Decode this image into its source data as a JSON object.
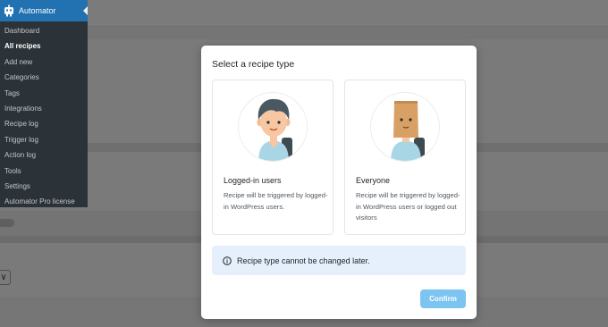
{
  "sidebar": {
    "title": "Automator",
    "items": [
      {
        "label": "Dashboard"
      },
      {
        "label": "All recipes"
      },
      {
        "label": "Add new"
      },
      {
        "label": "Categories"
      },
      {
        "label": "Tags"
      },
      {
        "label": "Integrations"
      },
      {
        "label": "Recipe log"
      },
      {
        "label": "Trigger log"
      },
      {
        "label": "Action log"
      },
      {
        "label": "Tools"
      },
      {
        "label": "Settings"
      },
      {
        "label": "Automator Pro license"
      }
    ],
    "active_item": "All recipes"
  },
  "background": {
    "select_glyph": "∨"
  },
  "modal": {
    "title": "Select a recipe type",
    "options": [
      {
        "title": "Logged-in users",
        "description": "Recipe will be triggered by logged-in WordPress users.",
        "icon": "user-avatar-icon"
      },
      {
        "title": "Everyone",
        "description": "Recipe will be triggered by logged-in WordPress users or logged out visitors",
        "icon": "paper-bag-avatar-icon"
      }
    ],
    "notice": "Recipe type cannot be changed later.",
    "confirm_label": "Confirm"
  },
  "colors": {
    "sidebar_bg": "#2c3338",
    "sidebar_active_bg": "#2271b1",
    "notice_bg": "#e5f0fc",
    "confirm_bg": "#7cc4f2"
  }
}
